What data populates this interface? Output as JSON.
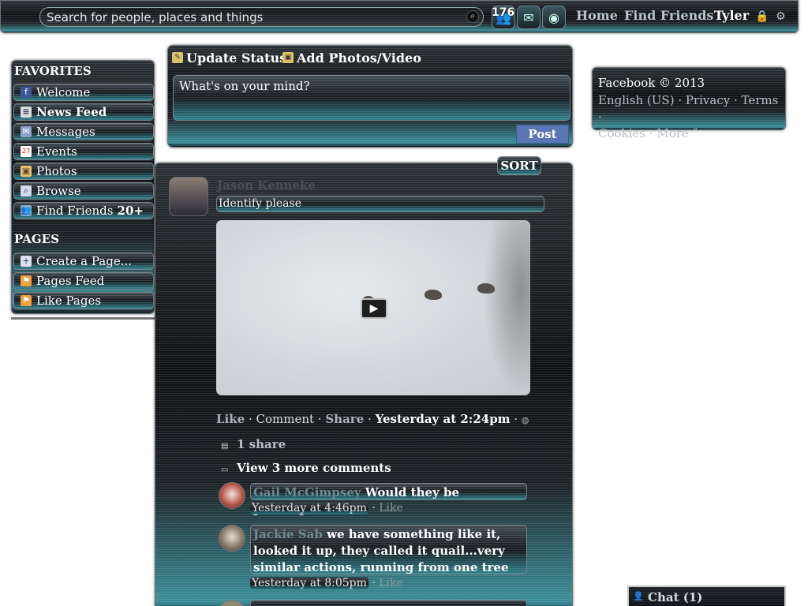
{
  "topbar": {
    "search_placeholder": "Search for people, places and things",
    "friend_requests_count": "176",
    "nav": {
      "home": "Home",
      "find_friends": "Find Friends",
      "user": "Tyler"
    }
  },
  "sidebar": {
    "favorites_heading": "FAVORITES",
    "favorites": [
      {
        "label": "Welcome",
        "icon": "facebook-icon"
      },
      {
        "label": "News Feed",
        "icon": "news-feed-icon"
      },
      {
        "label": "Messages",
        "icon": "messages-icon"
      },
      {
        "label": "Events",
        "icon": "calendar-icon"
      },
      {
        "label": "Photos",
        "icon": "photos-icon"
      },
      {
        "label": "Browse",
        "icon": "magnifier-icon"
      },
      {
        "label": "Find Friends",
        "icon": "friends-icon",
        "badge": "20+"
      }
    ],
    "pages_heading": "PAGES",
    "pages": [
      {
        "label": "Create a Page...",
        "icon": "create-page-icon"
      },
      {
        "label": "Pages Feed",
        "icon": "pages-feed-icon"
      },
      {
        "label": "Like Pages",
        "icon": "like-pages-icon"
      }
    ]
  },
  "composer": {
    "tab_status": "Update Status",
    "tab_photo": "Add Photos/Video",
    "placeholder": "What's on your mind?",
    "post_label": "Post"
  },
  "right": {
    "copyright": "Facebook © 2013",
    "links_line1": "English (US) · Privacy · Terms ·",
    "links_line2": "Cookies · More ˅"
  },
  "feed": {
    "sort_label": "SORT",
    "post": {
      "author": "Jason Kenneke",
      "text": "Identify please",
      "actions": {
        "like": "Like",
        "comment": "Comment",
        "share": "Share",
        "time": "Yesterday at 2:24pm"
      },
      "shares": "1 share",
      "view_more_comments": "View 3 more comments",
      "comments": [
        {
          "author": "Gail McGimpsey",
          "text": "Would they be ptarmigan?",
          "time": "Yesterday at 4:46pm",
          "like": "Like"
        },
        {
          "author": "Jackie Sab",
          "text": "we have something like it, looked it up, they called it quail...very similar actions, running from one tree to the next",
          "time": "Yesterday at 8:05pm",
          "like": "Like"
        }
      ]
    }
  },
  "chat": {
    "label": "Chat (1)"
  }
}
